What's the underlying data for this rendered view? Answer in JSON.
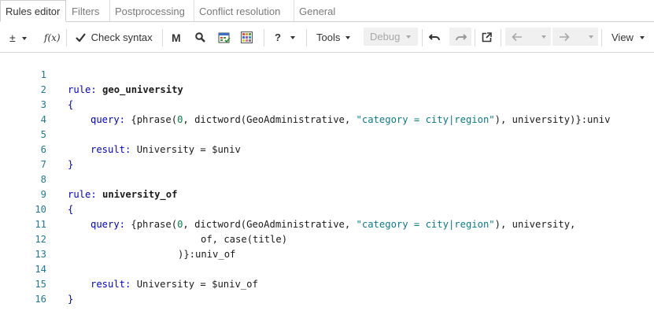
{
  "tabs": [
    {
      "label": "Rules editor",
      "active": true
    },
    {
      "label": "Filters",
      "active": false
    },
    {
      "label": "Postprocessing",
      "active": false
    },
    {
      "label": "Conflict resolution",
      "active": false
    },
    {
      "label": "General",
      "active": false
    }
  ],
  "toolbar": {
    "plusminus_label": "±",
    "fx_label": "f(x)",
    "check_syntax_label": "Check syntax",
    "m_label": "M",
    "help_label": "?",
    "tools_label": "Tools",
    "debug_label": "Debug",
    "view_label": "View"
  },
  "editor": {
    "lines": [
      {
        "n": "1"
      },
      {
        "n": "2"
      },
      {
        "n": "3"
      },
      {
        "n": "4"
      },
      {
        "n": "5"
      },
      {
        "n": "6"
      },
      {
        "n": "7"
      },
      {
        "n": "8"
      },
      {
        "n": "9"
      },
      {
        "n": "10"
      },
      {
        "n": "11"
      },
      {
        "n": "12"
      },
      {
        "n": "13"
      },
      {
        "n": "14"
      },
      {
        "n": "15"
      },
      {
        "n": "16"
      }
    ],
    "code": {
      "l1_kw": "rule:",
      "l1_name": "geo_university",
      "l2": "{",
      "l3_kw": "query:",
      "l3_a": "{phrase(",
      "l3_num": "0",
      "l3_b": ", dictword(GeoAdministrative, ",
      "l3_str": "\"category = city|region\"",
      "l3_c": "), university)}:univ",
      "l5_kw": "result:",
      "l5_rest": "University = $univ",
      "l6": "}",
      "l8_kw": "rule:",
      "l8_name": "university_of",
      "l9": "{",
      "l10_kw": "query:",
      "l10_a": "{phrase(",
      "l10_num": "0",
      "l10_b": ", dictword(GeoAdministrative, ",
      "l10_str": "\"category = city|region\"",
      "l10_c": "), university,",
      "l11": "of, case(title)",
      "l12": ")}:univ_of",
      "l14_kw": "result:",
      "l14_rest": "University = $univ_of",
      "l15": "}"
    }
  },
  "colors": {
    "line_number": "#237893",
    "keyword": "#0000cc",
    "string": "#0a7a8a"
  }
}
